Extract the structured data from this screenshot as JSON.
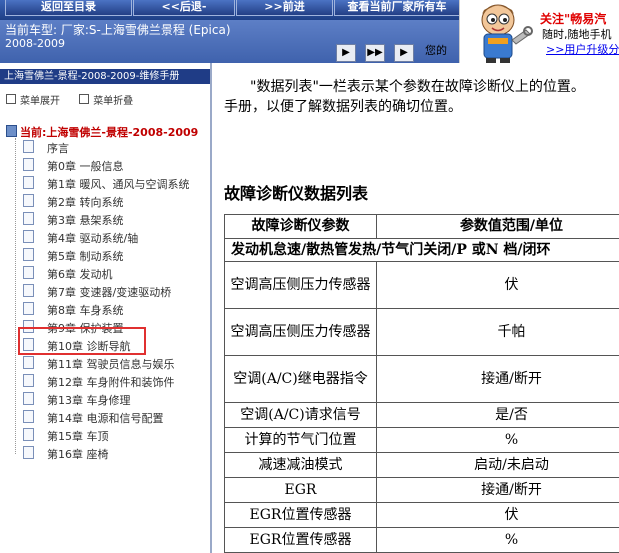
{
  "nav": {
    "buttons": [
      "返回至目录",
      "<<后退-",
      ">>前进",
      "查看当前厂家所有车"
    ]
  },
  "header": {
    "car_title": "当前车型:  厂家:S-上海雪佛兰景程 (Epica)",
    "car_year": "2008-2009",
    "pager_buttons": [
      "▶",
      "▶▶",
      "▶"
    ],
    "note": "您的"
  },
  "promo": {
    "line1": "关注\"畅易汽",
    "line2": "随时,随地手机",
    "link": ">>用户升级分",
    "mascot_icon": "mechanic-mascot-icon"
  },
  "sidebar": {
    "title": "上海雪佛兰-景程-2008-2009-维修手册",
    "tools": [
      "菜单展开",
      "菜单折叠"
    ],
    "root": "当前:上海雪佛兰-景程-2008-2009",
    "items": [
      "序言",
      "第0章 一般信息",
      "第1章 暖风、通风与空调系统",
      "第2章 转向系统",
      "第3章 悬架系统",
      "第4章 驱动系统/轴",
      "第5章 制动系统",
      "第6章 发动机",
      "第7章 变速器/变速驱动桥",
      "第8章 车身系统",
      "第9章 保护装置",
      "第10章 诊断导航",
      "第11章 驾驶员信息与娱乐",
      "第12章 车身附件和装饰件",
      "第13章 车身修理",
      "第14章 电源和信号配置",
      "第15章 车顶",
      "第16章 座椅"
    ],
    "highlight_color": "#e03030"
  },
  "content": {
    "intro_line1": "\"数据列表\"一栏表示某个参数在故障诊断仪上的位置。",
    "intro_line2": "手册，以便了解数据列表的确切位置。",
    "section_title": "故障诊断仪数据列表",
    "table": {
      "headers": [
        "故障诊断仪参数",
        "参数值范围/单位"
      ],
      "subheader": "发动机怠速/散热管发热/节气门关闭/P 或N 档/闭环",
      "rows": [
        [
          "空调高压侧压力传感器",
          "伏"
        ],
        [
          "空调高压侧压力传感器",
          "千帕"
        ],
        [
          "空调(A/C)继电器指令",
          "接通/断开"
        ],
        [
          "空调(A/C)请求信号",
          "是/否"
        ],
        [
          "计算的节气门位置",
          "%"
        ],
        [
          "减速减油模式",
          "启动/未启动"
        ],
        [
          "EGR",
          "接通/断开"
        ],
        [
          "EGR位置传感器",
          "伏"
        ],
        [
          "EGR位置传感器",
          "%"
        ]
      ]
    }
  }
}
